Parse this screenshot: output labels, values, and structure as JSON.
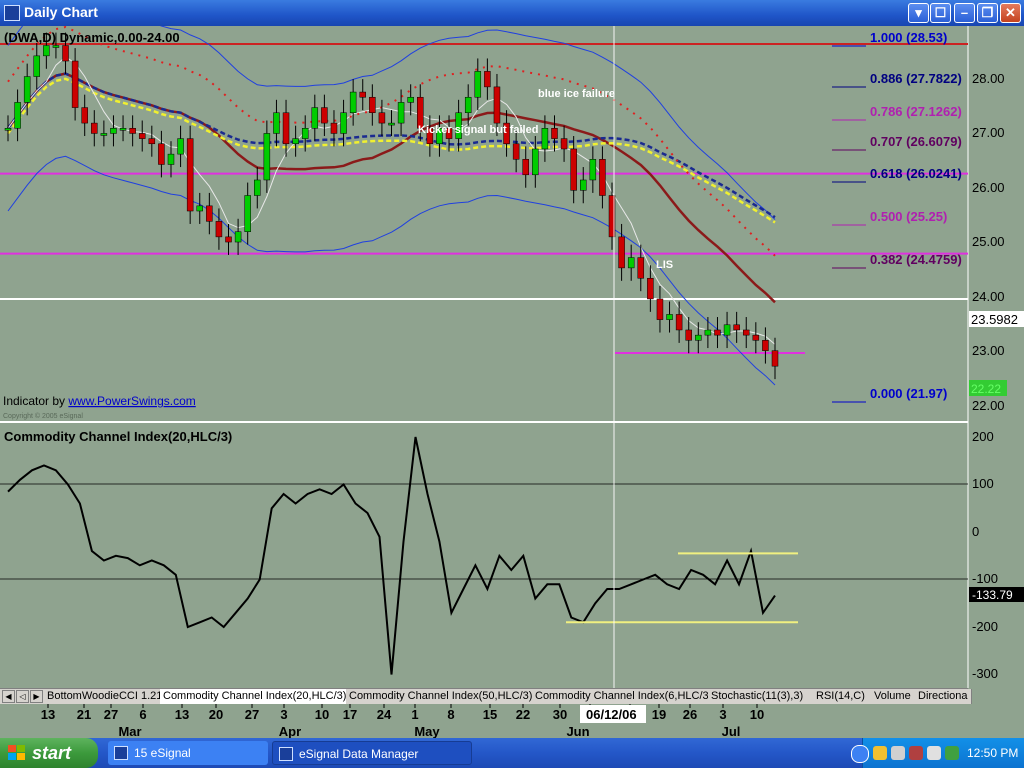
{
  "window": {
    "title": "Daily Chart",
    "controls": [
      "▾",
      "☐",
      "–",
      "❐",
      "✕"
    ]
  },
  "price_panel": {
    "symbol_label": "(DWA,D) Dynamic,0.00-24.00",
    "indicator_prefix": "Indicator by ",
    "indicator_link": "www.PowerSwings.com",
    "copyright": "Copyright © 2005 eSignal",
    "annotations": [
      "blue ice failure",
      "Kicker signal but failed",
      "LIS"
    ],
    "last_price_tag": "23.5982",
    "current_price_tag": "22.22",
    "price_axis": [
      "28.00",
      "27.00",
      "26.00",
      "25.00",
      "24.00",
      "23.00",
      "22.00"
    ],
    "fib_levels": [
      {
        "label": "1.000 (28.53)",
        "color": "#0000CC"
      },
      {
        "label": "0.886 (27.7822)",
        "color": "#000080"
      },
      {
        "label": "0.786 (27.1262)",
        "color": "#B020B0"
      },
      {
        "label": "0.707 (26.6079)",
        "color": "#600060"
      },
      {
        "label": "0.618 (26.0241)",
        "color": "#000080"
      },
      {
        "label": "0.500 (25.25)",
        "color": "#B020B0"
      },
      {
        "label": "0.382 (24.4759)",
        "color": "#600060"
      },
      {
        "label": "0.000 (21.97)",
        "color": "#0000CC"
      }
    ]
  },
  "cci_panel": {
    "title": "Commodity Channel Index(20,HLC/3)",
    "value_tag": "-133.79",
    "axis": [
      "200",
      "100",
      "0",
      "-100",
      "-200",
      "-300"
    ]
  },
  "cursor_date": "06/12/06",
  "tabs": [
    "BottomWoodieCCI 1.21",
    "Commodity Channel Index(20,HLC/3)",
    "Commodity Channel Index(50,HLC/3)",
    "Commodity Channel Index(6,HLC/3)",
    "Stochastic(11(3),3)",
    "RSI(14,C)",
    "Volume",
    "Directiona"
  ],
  "x_axis_days": [
    "13",
    "21",
    "27",
    "6",
    "13",
    "20",
    "27",
    "3",
    "10",
    "17",
    "24",
    "1",
    "8",
    "15",
    "22",
    "30",
    "5",
    "12",
    "19",
    "26",
    "3",
    "10"
  ],
  "x_axis_months": [
    "Mar",
    "Apr",
    "May",
    "Jun",
    "Jul"
  ],
  "chart_data": {
    "type": "candlestick",
    "ylim": [
      21.7,
      28.8
    ],
    "lines": [
      {
        "name": "resistance",
        "y": 28.53,
        "color": "#CC2222"
      },
      {
        "name": "magenta-1",
        "y": 26.0241,
        "color": "#E030E0"
      },
      {
        "name": "magenta-2",
        "y": 24.4759,
        "color": "#E030E0"
      },
      {
        "name": "white",
        "y": 23.5982,
        "color": "#FFFFFF"
      }
    ],
    "closes": [
      26.9,
      27.4,
      27.9,
      28.3,
      28.5,
      28.5,
      28.2,
      27.3,
      27.0,
      26.8,
      26.8,
      26.9,
      26.9,
      26.8,
      26.7,
      26.6,
      26.2,
      26.4,
      26.7,
      25.3,
      25.4,
      25.1,
      24.8,
      24.7,
      24.9,
      25.6,
      25.9,
      26.8,
      27.2,
      26.6,
      26.7,
      26.9,
      27.3,
      27.0,
      26.8,
      27.2,
      27.6,
      27.5,
      27.2,
      27.0,
      27.0,
      27.4,
      27.5,
      26.9,
      26.6,
      26.9,
      26.7,
      27.2,
      27.5,
      28.0,
      27.7,
      27.0,
      26.6,
      26.3,
      26.0,
      26.5,
      26.9,
      26.7,
      26.5,
      25.7,
      25.9,
      26.3,
      25.6,
      24.8,
      24.2,
      24.4,
      24.0,
      23.6,
      23.2,
      23.3,
      23.0,
      22.8,
      22.9,
      23.0,
      22.9,
      23.1,
      23.0,
      22.9,
      22.8,
      22.6,
      22.3
    ],
    "cci": [
      85,
      110,
      130,
      140,
      130,
      100,
      60,
      -40,
      -60,
      -50,
      -55,
      -70,
      -60,
      -70,
      -90,
      -200,
      -190,
      -180,
      -200,
      -170,
      -140,
      -100,
      50,
      80,
      60,
      80,
      90,
      80,
      100,
      60,
      40,
      -10,
      -300,
      -20,
      200,
      80,
      -20,
      -170,
      -120,
      -70,
      -120,
      -50,
      -80,
      -50,
      -140,
      -110,
      -110,
      -180,
      -190,
      -150,
      -120,
      -120,
      -110,
      -100,
      -90,
      -110,
      -120,
      -80,
      -90,
      -110,
      -60,
      -110,
      -40,
      -170,
      -133.79
    ],
    "cci_bands": [
      -45,
      -190
    ]
  }
}
